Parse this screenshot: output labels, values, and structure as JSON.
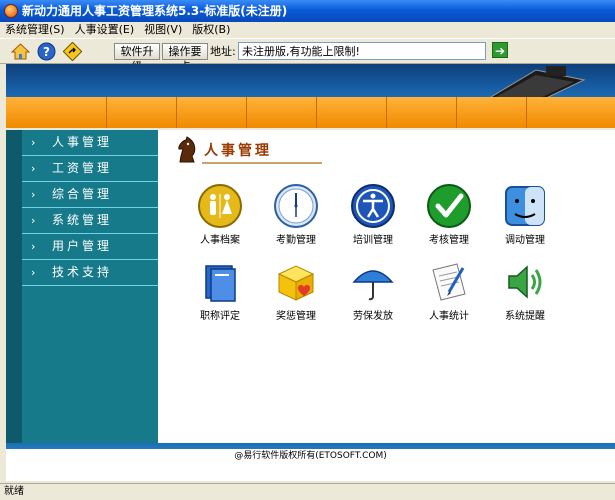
{
  "window": {
    "title": "新动力通用人事工资管理系统5.3-标准版(未注册)"
  },
  "menu": [
    "系统管理(S)",
    "人事设置(E)",
    "视图(V)",
    "版权(B)"
  ],
  "toolbar": {
    "upgrade_label": "软件升级",
    "guide_label": "操作要点",
    "address_label": "地址:",
    "address_value": "未注册版,有功能上限制!"
  },
  "sidebar": {
    "items": [
      {
        "label": "人事管理"
      },
      {
        "label": "工资管理"
      },
      {
        "label": "综合管理"
      },
      {
        "label": "系统管理"
      },
      {
        "label": "用户管理"
      },
      {
        "label": "技术支持"
      }
    ]
  },
  "content": {
    "section_title": "人事管理",
    "tiles": [
      {
        "label": "人事档案",
        "icon": "restroom-icon"
      },
      {
        "label": "考勤管理",
        "icon": "clock-icon"
      },
      {
        "label": "培训管理",
        "icon": "accessibility-icon"
      },
      {
        "label": "考核管理",
        "icon": "checkmark-icon"
      },
      {
        "label": "调动管理",
        "icon": "finder-icon"
      },
      {
        "label": "职称评定",
        "icon": "books-icon"
      },
      {
        "label": "奖惩管理",
        "icon": "gift-box-icon"
      },
      {
        "label": "劳保发放",
        "icon": "umbrella-icon"
      },
      {
        "label": "人事统计",
        "icon": "document-pen-icon"
      },
      {
        "label": "系统提醒",
        "icon": "speaker-icon"
      }
    ]
  },
  "footer": {
    "copyright": "@易行软件版权所有(ETOSOFT.COM)"
  },
  "status": {
    "text": "就绪"
  },
  "colors": {
    "sidebar": "#177a8a",
    "banner_orange": "#f08a00",
    "title_bar": "#0a5bd9"
  }
}
